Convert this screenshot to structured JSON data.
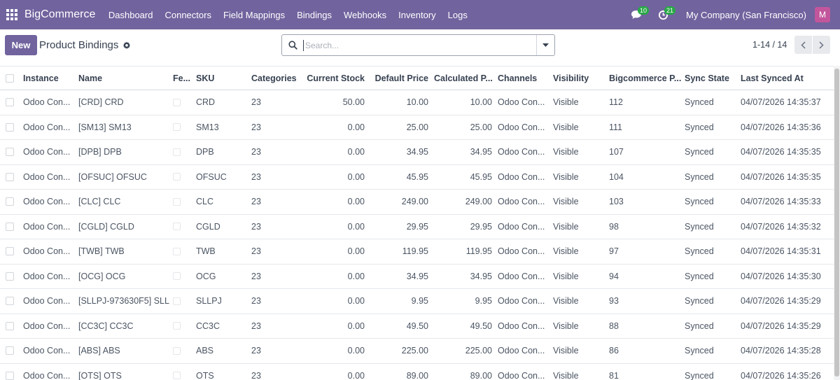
{
  "navbar": {
    "brand": "BigCommerce",
    "menu": [
      "Dashboard",
      "Connectors",
      "Field Mappings",
      "Bindings",
      "Webhooks",
      "Inventory",
      "Logs"
    ],
    "messages_count": "10",
    "activities_count": "21",
    "company": "My Company (San Francisco)",
    "avatar_initial": "M"
  },
  "control": {
    "new_label": "New",
    "title": "Product Bindings",
    "search_placeholder": "Search...",
    "pager": "1-14 / 14"
  },
  "columns": [
    "Instance",
    "Name",
    "Fe...",
    "SKU",
    "Categories",
    "Current Stock",
    "Default Price",
    "Calculated P...",
    "Channels",
    "Visibility",
    "Bigcommerce P...",
    "Sync State",
    "Last Synced At"
  ],
  "rows": [
    {
      "instance": "Odoo Con...",
      "name": "[CRD] CRD",
      "sku": "CRD",
      "categories": "23",
      "stock": "50.00",
      "default_price": "10.00",
      "calc_price": "10.00",
      "channels": "Odoo Con...",
      "visibility": "Visible",
      "bc_id": "112",
      "sync": "Synced",
      "last_synced": "04/07/2026 14:35:37"
    },
    {
      "instance": "Odoo Con...",
      "name": "[SM13] SM13",
      "sku": "SM13",
      "categories": "23",
      "stock": "0.00",
      "default_price": "25.00",
      "calc_price": "25.00",
      "channels": "Odoo Con...",
      "visibility": "Visible",
      "bc_id": "111",
      "sync": "Synced",
      "last_synced": "04/07/2026 14:35:36"
    },
    {
      "instance": "Odoo Con...",
      "name": "[DPB] DPB",
      "sku": "DPB",
      "categories": "23",
      "stock": "0.00",
      "default_price": "34.95",
      "calc_price": "34.95",
      "channels": "Odoo Con...",
      "visibility": "Visible",
      "bc_id": "107",
      "sync": "Synced",
      "last_synced": "04/07/2026 14:35:35"
    },
    {
      "instance": "Odoo Con...",
      "name": "[OFSUC] OFSUC",
      "sku": "OFSUC",
      "categories": "23",
      "stock": "0.00",
      "default_price": "45.95",
      "calc_price": "45.95",
      "channels": "Odoo Con...",
      "visibility": "Visible",
      "bc_id": "104",
      "sync": "Synced",
      "last_synced": "04/07/2026 14:35:35"
    },
    {
      "instance": "Odoo Con...",
      "name": "[CLC] CLC",
      "sku": "CLC",
      "categories": "23",
      "stock": "0.00",
      "default_price": "249.00",
      "calc_price": "249.00",
      "channels": "Odoo Con...",
      "visibility": "Visible",
      "bc_id": "103",
      "sync": "Synced",
      "last_synced": "04/07/2026 14:35:33"
    },
    {
      "instance": "Odoo Con...",
      "name": "[CGLD] CGLD",
      "sku": "CGLD",
      "categories": "23",
      "stock": "0.00",
      "default_price": "29.95",
      "calc_price": "29.95",
      "channels": "Odoo Con...",
      "visibility": "Visible",
      "bc_id": "98",
      "sync": "Synced",
      "last_synced": "04/07/2026 14:35:32"
    },
    {
      "instance": "Odoo Con...",
      "name": "[TWB] TWB",
      "sku": "TWB",
      "categories": "23",
      "stock": "0.00",
      "default_price": "119.95",
      "calc_price": "119.95",
      "channels": "Odoo Con...",
      "visibility": "Visible",
      "bc_id": "97",
      "sync": "Synced",
      "last_synced": "04/07/2026 14:35:31"
    },
    {
      "instance": "Odoo Con...",
      "name": "[OCG] OCG",
      "sku": "OCG",
      "categories": "23",
      "stock": "0.00",
      "default_price": "34.95",
      "calc_price": "34.95",
      "channels": "Odoo Con...",
      "visibility": "Visible",
      "bc_id": "94",
      "sync": "Synced",
      "last_synced": "04/07/2026 14:35:30"
    },
    {
      "instance": "Odoo Con...",
      "name": "[SLLPJ-973630F5] SLL...",
      "sku": "SLLPJ",
      "categories": "23",
      "stock": "0.00",
      "default_price": "9.95",
      "calc_price": "9.95",
      "channels": "Odoo Con...",
      "visibility": "Visible",
      "bc_id": "93",
      "sync": "Synced",
      "last_synced": "04/07/2026 14:35:29"
    },
    {
      "instance": "Odoo Con...",
      "name": "[CC3C] CC3C",
      "sku": "CC3C",
      "categories": "23",
      "stock": "0.00",
      "default_price": "49.50",
      "calc_price": "49.50",
      "channels": "Odoo Con...",
      "visibility": "Visible",
      "bc_id": "88",
      "sync": "Synced",
      "last_synced": "04/07/2026 14:35:29"
    },
    {
      "instance": "Odoo Con...",
      "name": "[ABS] ABS",
      "sku": "ABS",
      "categories": "23",
      "stock": "0.00",
      "default_price": "225.00",
      "calc_price": "225.00",
      "channels": "Odoo Con...",
      "visibility": "Visible",
      "bc_id": "86",
      "sync": "Synced",
      "last_synced": "04/07/2026 14:35:28"
    },
    {
      "instance": "Odoo Con...",
      "name": "[OTS] OTS",
      "sku": "OTS",
      "categories": "23",
      "stock": "0.00",
      "default_price": "89.00",
      "calc_price": "89.00",
      "channels": "Odoo Con...",
      "visibility": "Visible",
      "bc_id": "81",
      "sync": "Synced",
      "last_synced": "04/07/2026 14:35:26"
    }
  ],
  "colors": {
    "navbar": "#71639e",
    "primary": "#71639e",
    "badge": "#28a745",
    "avatar": "#c2569c"
  }
}
